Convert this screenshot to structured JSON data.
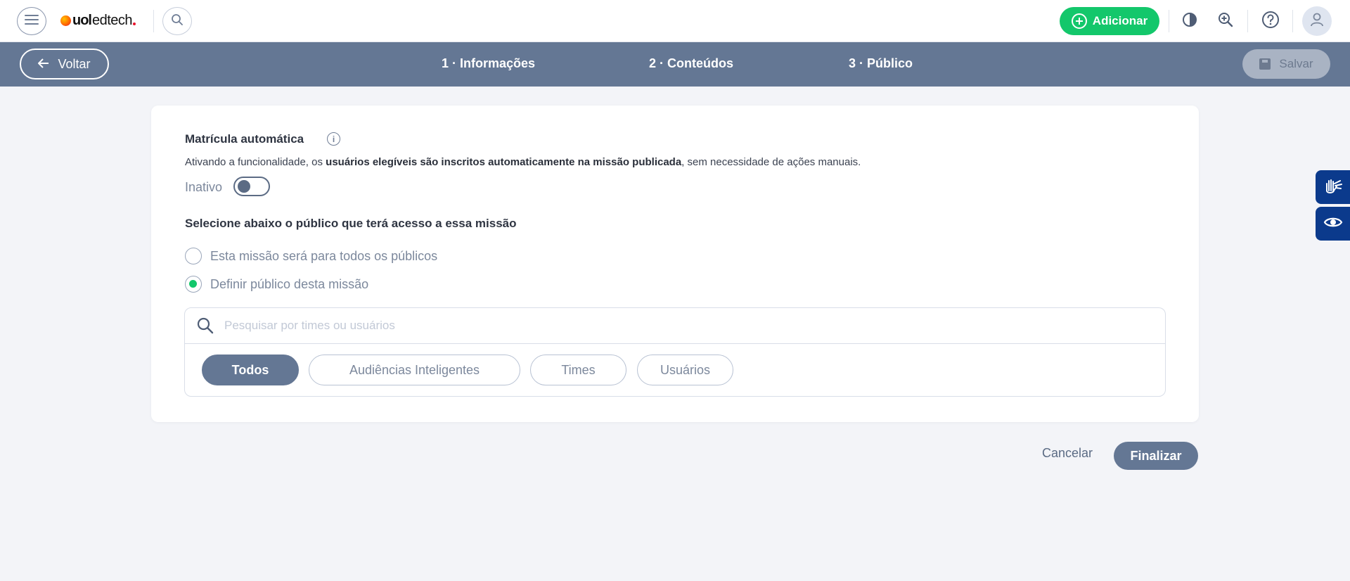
{
  "header": {
    "logo_uol": "uol",
    "logo_edtech": "edtech",
    "add_label": "Adicionar",
    "colors": {
      "brand_green": "#13c76b",
      "slate": "#647794"
    }
  },
  "stepbar": {
    "back_label": "Voltar",
    "steps": [
      {
        "label": "1 · Informações"
      },
      {
        "label": "2 · Conteúdos"
      },
      {
        "label": "3 · Público"
      }
    ],
    "save_label": "Salvar"
  },
  "form": {
    "auto_title": "Matrícula automática",
    "info_glyph": "i",
    "desc_pre": "Ativando a funcionalidade, os ",
    "desc_bold": "usuários elegíveis são inscritos automaticamente na missão publicada",
    "desc_post": ", sem necessidade de ações manuais.",
    "toggle_label": "Inativo",
    "toggle_on": false,
    "audience_title": "Selecione abaixo o público que terá acesso a essa missão",
    "radio_all": "Esta missão será para todos os públicos",
    "radio_define": "Definir público desta missão",
    "selected_radio": "define",
    "search": {
      "placeholder": "Pesquisar por times ou usuários",
      "value": ""
    },
    "chips": [
      {
        "label": "Todos",
        "active": true
      },
      {
        "label": "Audiências Inteligentes",
        "active": false
      },
      {
        "label": "Times",
        "active": false
      },
      {
        "label": "Usuários",
        "active": false
      }
    ]
  },
  "footer": {
    "cancel_label": "Cancelar",
    "finish_label": "Finalizar"
  },
  "side": {
    "icons": [
      "sign-language-icon",
      "eye-icon"
    ]
  }
}
